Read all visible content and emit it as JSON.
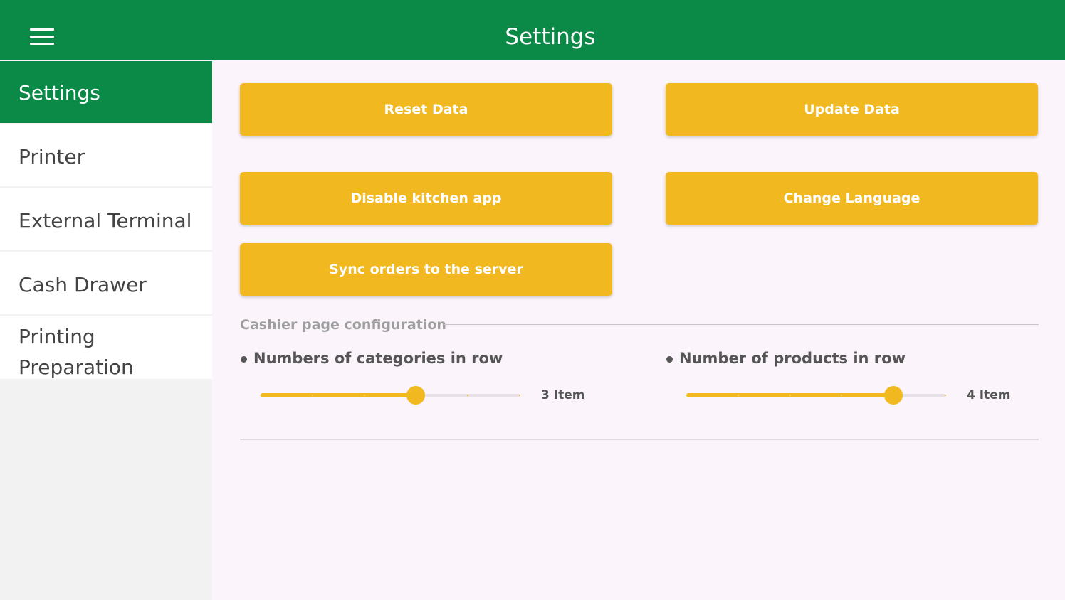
{
  "app": {
    "title": "Settings",
    "menu_icon": "hamburger-menu-icon"
  },
  "colors": {
    "primary": "#0b8a47",
    "accent": "#f1b81f",
    "background": "#fbf5fb"
  },
  "sidebar": {
    "items": [
      {
        "label": "Settings",
        "active": true
      },
      {
        "label": "Printer",
        "active": false
      },
      {
        "label": "External Terminal",
        "active": false
      },
      {
        "label": "Cash Drawer",
        "active": false
      },
      {
        "label": "Printing\nPreparation",
        "active": false
      }
    ]
  },
  "buttons": {
    "reset": "Reset Data",
    "update": "Update Data",
    "disable_kitchen": "Disable kitchen app",
    "change_language": "Change Language",
    "sync": "Sync orders to the server"
  },
  "cashier": {
    "section_title": "Cashier page configuration",
    "categories": {
      "label": "Numbers of categories in row",
      "value_text": "3 Item",
      "value": 3,
      "min": 0,
      "max": 5
    },
    "products": {
      "label": "Number of products in row",
      "value_text": "4 Item",
      "value": 4,
      "min": 0,
      "max": 5
    }
  }
}
